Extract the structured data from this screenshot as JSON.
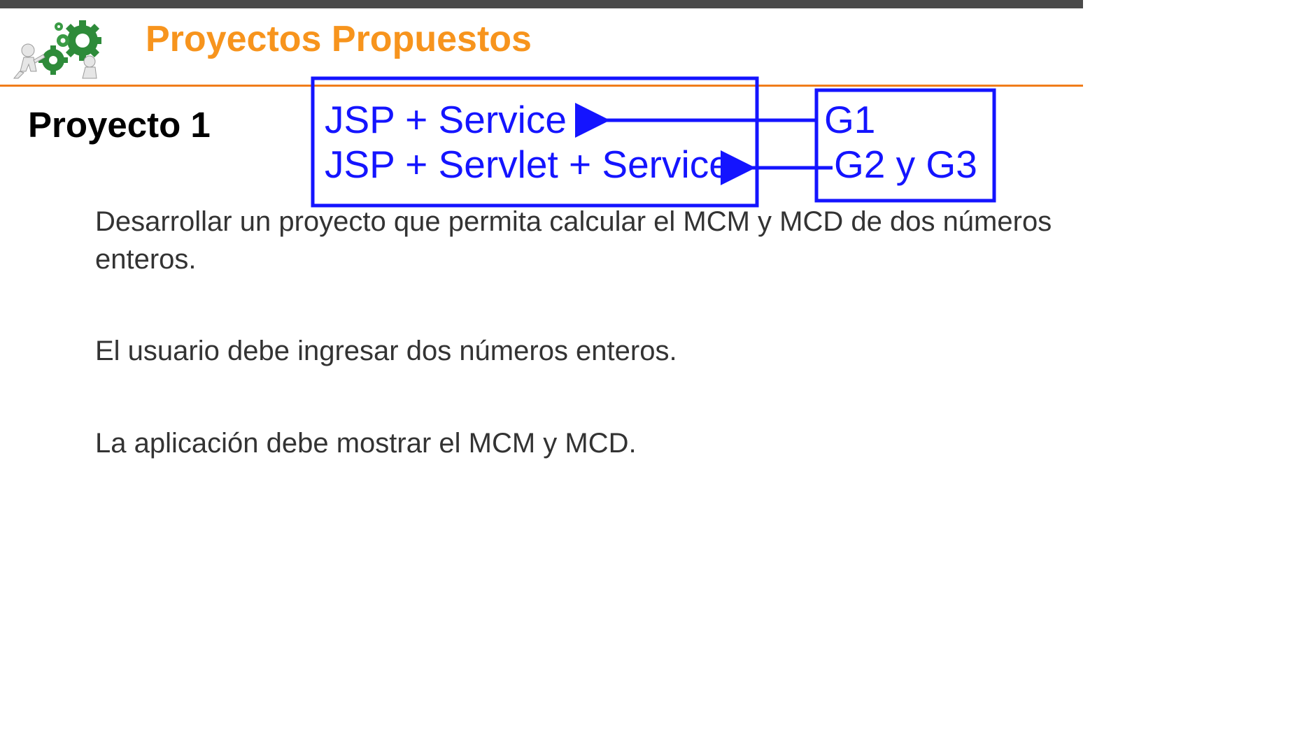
{
  "slide": {
    "title": "Proyectos Propuestos",
    "subtitle": "Proyecto 1",
    "paragraphs": [
      "Desarrollar un proyecto que permita calcular el MCM y MCD de dos números enteros.",
      "El usuario debe ingresar dos números enteros.",
      "La aplicación debe mostrar el MCM y MCD."
    ],
    "logo_icon": "gears-people-logo-icon"
  },
  "annotation": {
    "left_box": [
      "JSP + Service",
      "JSP + Servlet + Service"
    ],
    "right_box": [
      "G1",
      "G2 y G3"
    ],
    "color": "#1414ff"
  },
  "colors": {
    "title": "#f7941d",
    "rule": "#f07d1a",
    "body": "#333333",
    "top_bar": "#4a4a4a"
  }
}
